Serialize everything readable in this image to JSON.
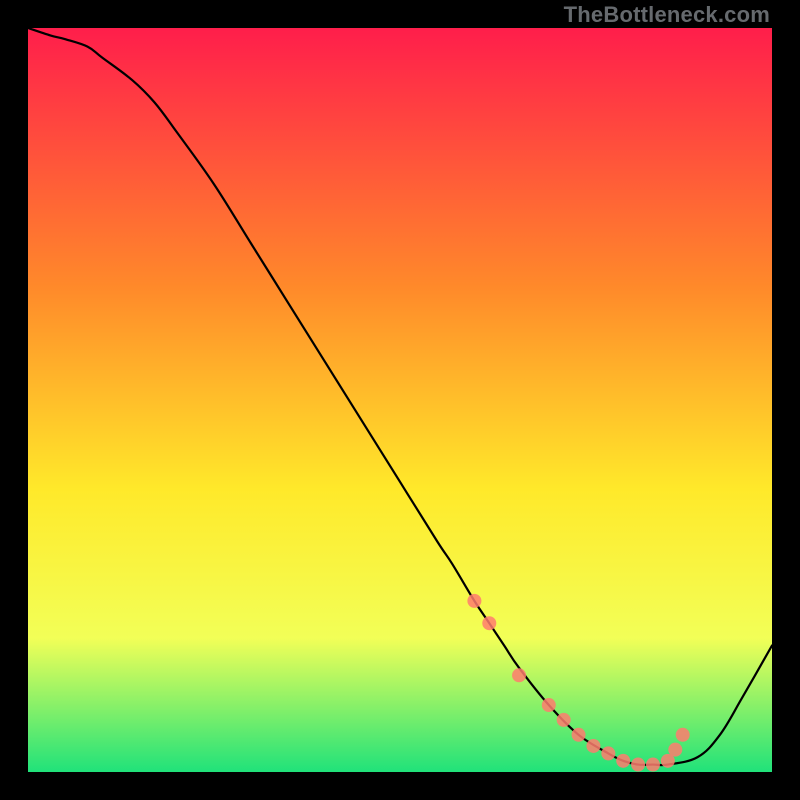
{
  "watermark": "TheBottleneck.com",
  "chart_data": {
    "type": "line",
    "title": "",
    "xlabel": "",
    "ylabel": "",
    "xlim": [
      0,
      100
    ],
    "ylim": [
      0,
      100
    ],
    "grid": false,
    "legend": false,
    "background_gradient": {
      "top": "#ff1e4b",
      "mid_upper": "#ff8a2a",
      "mid": "#ffe92a",
      "mid_lower": "#f2ff57",
      "bottom": "#20e27a"
    },
    "series": [
      {
        "name": "bottleneck-curve",
        "color": "#000000",
        "x": [
          0,
          3,
          5,
          8,
          10,
          14,
          17,
          20,
          25,
          30,
          35,
          40,
          45,
          50,
          55,
          57,
          60,
          62,
          64,
          66,
          70,
          74,
          78,
          80,
          82,
          84,
          86,
          90,
          93,
          96,
          100
        ],
        "y": [
          100,
          99,
          98.5,
          97.5,
          96,
          93,
          90,
          86,
          79,
          71,
          63,
          55,
          47,
          39,
          31,
          28,
          23,
          20,
          17,
          14,
          9,
          5,
          2.5,
          1.5,
          1,
          1,
          1,
          2,
          5,
          10,
          17
        ]
      },
      {
        "name": "highlight-dots",
        "color": "#ff7b6e",
        "type": "scatter",
        "x": [
          60,
          62,
          66,
          70,
          72,
          74,
          76,
          78,
          80,
          82,
          84,
          86,
          87,
          88
        ],
        "y": [
          23,
          20,
          13,
          9,
          7,
          5,
          3.5,
          2.5,
          1.5,
          1,
          1,
          1.5,
          3,
          5
        ]
      }
    ]
  }
}
